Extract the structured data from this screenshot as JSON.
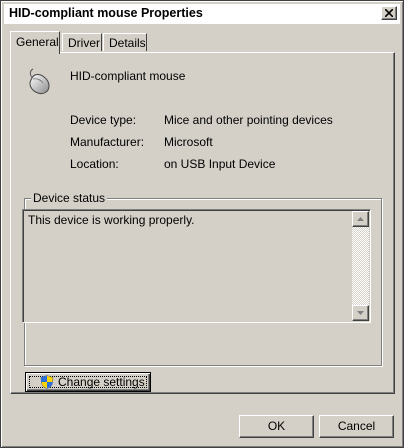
{
  "window": {
    "title": "HID-compliant mouse Properties"
  },
  "tabs": [
    {
      "label": "General",
      "active": true
    },
    {
      "label": "Driver",
      "active": false
    },
    {
      "label": "Details",
      "active": false
    }
  ],
  "device": {
    "name": "HID-compliant mouse",
    "icon": "mouse-icon",
    "properties": [
      {
        "label": "Device type:",
        "value": "Mice and other pointing devices"
      },
      {
        "label": "Manufacturer:",
        "value": "Microsoft"
      },
      {
        "label": "Location:",
        "value": "on USB Input Device"
      }
    ]
  },
  "status": {
    "group_label": "Device status",
    "text": "This device is working properly."
  },
  "buttons": {
    "change_settings": "Change settings",
    "ok": "OK",
    "cancel": "Cancel"
  }
}
